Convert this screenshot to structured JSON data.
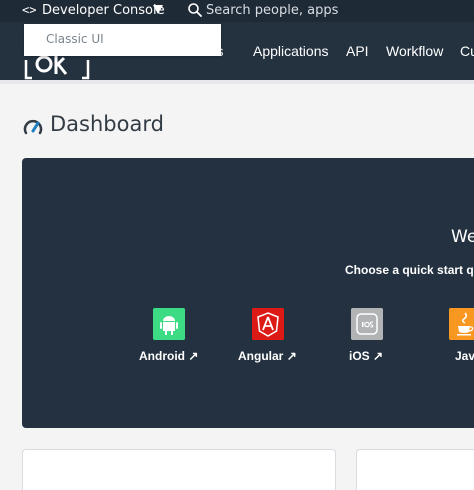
{
  "topbar": {
    "code_glyph": "<>",
    "console_label": "Developer Console",
    "search_placeholder": "Search people, apps"
  },
  "dropdown": {
    "items": [
      "Classic UI"
    ]
  },
  "nav": {
    "items": [
      "ers",
      "Applications",
      "API",
      "Workflow",
      "Cu"
    ]
  },
  "page": {
    "title": "Dashboard"
  },
  "hero": {
    "title": "We",
    "subtitle": "Choose a quick start q",
    "tiles": [
      {
        "label": "Android",
        "color": "#3ddc84",
        "icon": "android-icon"
      },
      {
        "label": "Angular",
        "color": "#dd1b16",
        "icon": "angular-icon"
      },
      {
        "label": "iOS",
        "color": "#b1b3b5",
        "icon": "ios-icon"
      },
      {
        "label": "Java",
        "color": "#f89820",
        "icon": "java-icon"
      }
    ],
    "arrow_glyph": "↗"
  },
  "colors": {
    "topbar": "#1f2a37",
    "navbar": "#243240",
    "hero": "#233140",
    "page_bg": "#f4f4f5"
  }
}
